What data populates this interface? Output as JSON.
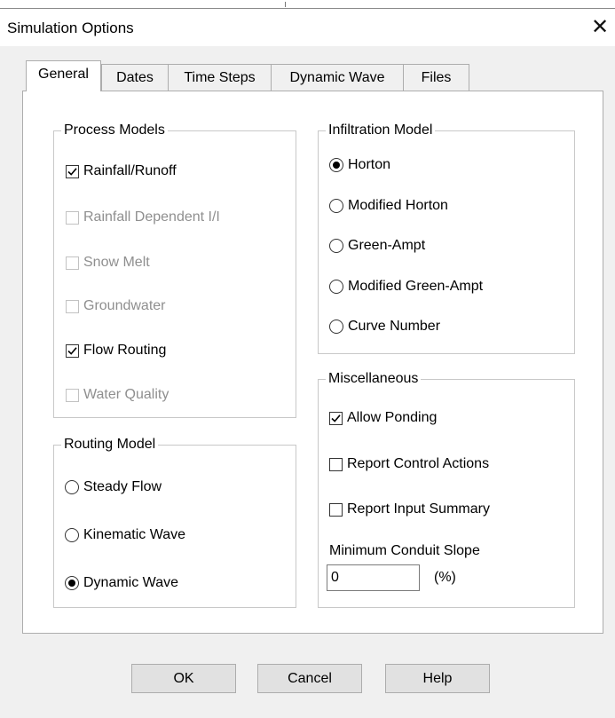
{
  "window": {
    "title": "Simulation Options",
    "close_glyph": "✕"
  },
  "tabs": [
    {
      "label": "General",
      "active": true
    },
    {
      "label": "Dates",
      "active": false
    },
    {
      "label": "Time Steps",
      "active": false
    },
    {
      "label": "Dynamic Wave",
      "active": false
    },
    {
      "label": "Files",
      "active": false
    }
  ],
  "process_models": {
    "label": "Process Models",
    "items": [
      {
        "label": "Rainfall/Runoff",
        "checked": true,
        "enabled": true
      },
      {
        "label": "Rainfall Dependent I/I",
        "checked": false,
        "enabled": false
      },
      {
        "label": "Snow Melt",
        "checked": false,
        "enabled": false
      },
      {
        "label": "Groundwater",
        "checked": false,
        "enabled": false
      },
      {
        "label": "Flow Routing",
        "checked": true,
        "enabled": true
      },
      {
        "label": "Water Quality",
        "checked": false,
        "enabled": false
      }
    ]
  },
  "routing_model": {
    "label": "Routing Model",
    "options": [
      {
        "label": "Steady Flow",
        "selected": false
      },
      {
        "label": "Kinematic Wave",
        "selected": false
      },
      {
        "label": "Dynamic Wave",
        "selected": true
      }
    ]
  },
  "infiltration_model": {
    "label": "Infiltration Model",
    "options": [
      {
        "label": "Horton",
        "selected": true
      },
      {
        "label": "Modified Horton",
        "selected": false
      },
      {
        "label": "Green-Ampt",
        "selected": false
      },
      {
        "label": "Modified Green-Ampt",
        "selected": false
      },
      {
        "label": "Curve Number",
        "selected": false
      }
    ]
  },
  "miscellaneous": {
    "label": "Miscellaneous",
    "items": [
      {
        "label": "Allow Ponding",
        "checked": true
      },
      {
        "label": "Report Control Actions",
        "checked": false
      },
      {
        "label": "Report Input Summary",
        "checked": false
      }
    ],
    "min_slope_label": "Minimum Conduit Slope",
    "min_slope_value": "0",
    "min_slope_unit": "(%)"
  },
  "buttons": {
    "ok": "OK",
    "cancel": "Cancel",
    "help": "Help"
  }
}
